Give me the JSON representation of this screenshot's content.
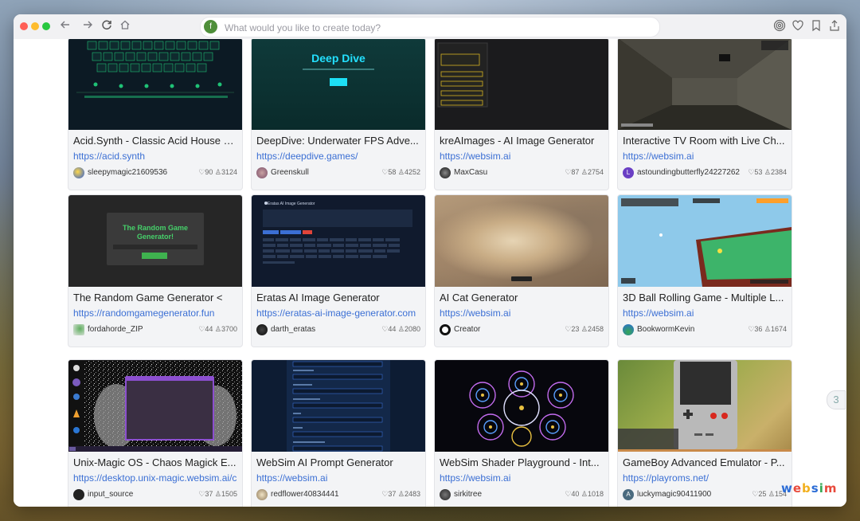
{
  "address_bar": {
    "avatar_letter": "f",
    "placeholder": "What would you like to create today?"
  },
  "logo_text": "websim",
  "side_tab": "3",
  "cards": [
    {
      "title": "Acid.Synth - Classic Acid House S...",
      "url": "https://acid.synth",
      "user": "sleepymagic21609536",
      "stats": "♡90 ♙3124"
    },
    {
      "title": "DeepDive: Underwater FPS Adve...",
      "url": "https://deepdive.games/",
      "user": "Greenskull",
      "stats": "♡58 ♙4252",
      "thumb_title": "Deep Dive"
    },
    {
      "title": "kreAImages - AI Image Generator",
      "url": "https://websim.ai",
      "user": "MaxCasu",
      "stats": "♡87 ♙2754"
    },
    {
      "title": "Interactive TV Room with Live Ch...",
      "url": "https://websim.ai",
      "user": "astoundingbutterfly24227262",
      "stats": "♡53 ♙2384",
      "avatar_letter": "L"
    },
    {
      "title": "The Random Game Generator <",
      "url": "https://randomgamegenerator.fun",
      "user": "fordahorde_ZIP",
      "stats": "♡44 ♙3700",
      "thumb_title": "The Random Game Generator!"
    },
    {
      "title": "Eratas AI Image Generator",
      "url": "https://eratas-ai-image-generator.com",
      "user": "darth_eratas",
      "stats": "♡44 ♙2080",
      "thumb_title": "Eratas AI Image Generator"
    },
    {
      "title": "AI Cat Generator",
      "url": "https://websim.ai",
      "user": "Creator",
      "stats": "♡23 ♙2458"
    },
    {
      "title": "3D Ball Rolling Game - Multiple L...",
      "url": "https://websim.ai",
      "user": "BookwormKevin",
      "stats": "♡36 ♙1674"
    },
    {
      "title": "Unix-Magic OS - Chaos Magick E...",
      "url": "https://desktop.unix-magic.websim.ai/cha",
      "user": "input_source",
      "stats": "♡37 ♙1505"
    },
    {
      "title": "WebSim AI Prompt Generator",
      "url": "https://websim.ai",
      "user": "redflower40834441",
      "stats": "♡37 ♙2483"
    },
    {
      "title": "WebSim Shader Playground - Int...",
      "url": "https://websim.ai",
      "user": "sirkitree",
      "stats": "♡40 ♙1018"
    },
    {
      "title": "GameBoy Advanced Emulator - P...",
      "url": "https://playroms.net/",
      "user": "luckymagic90411900",
      "stats": "♡25 ♙154",
      "avatar_letter": "A"
    }
  ]
}
